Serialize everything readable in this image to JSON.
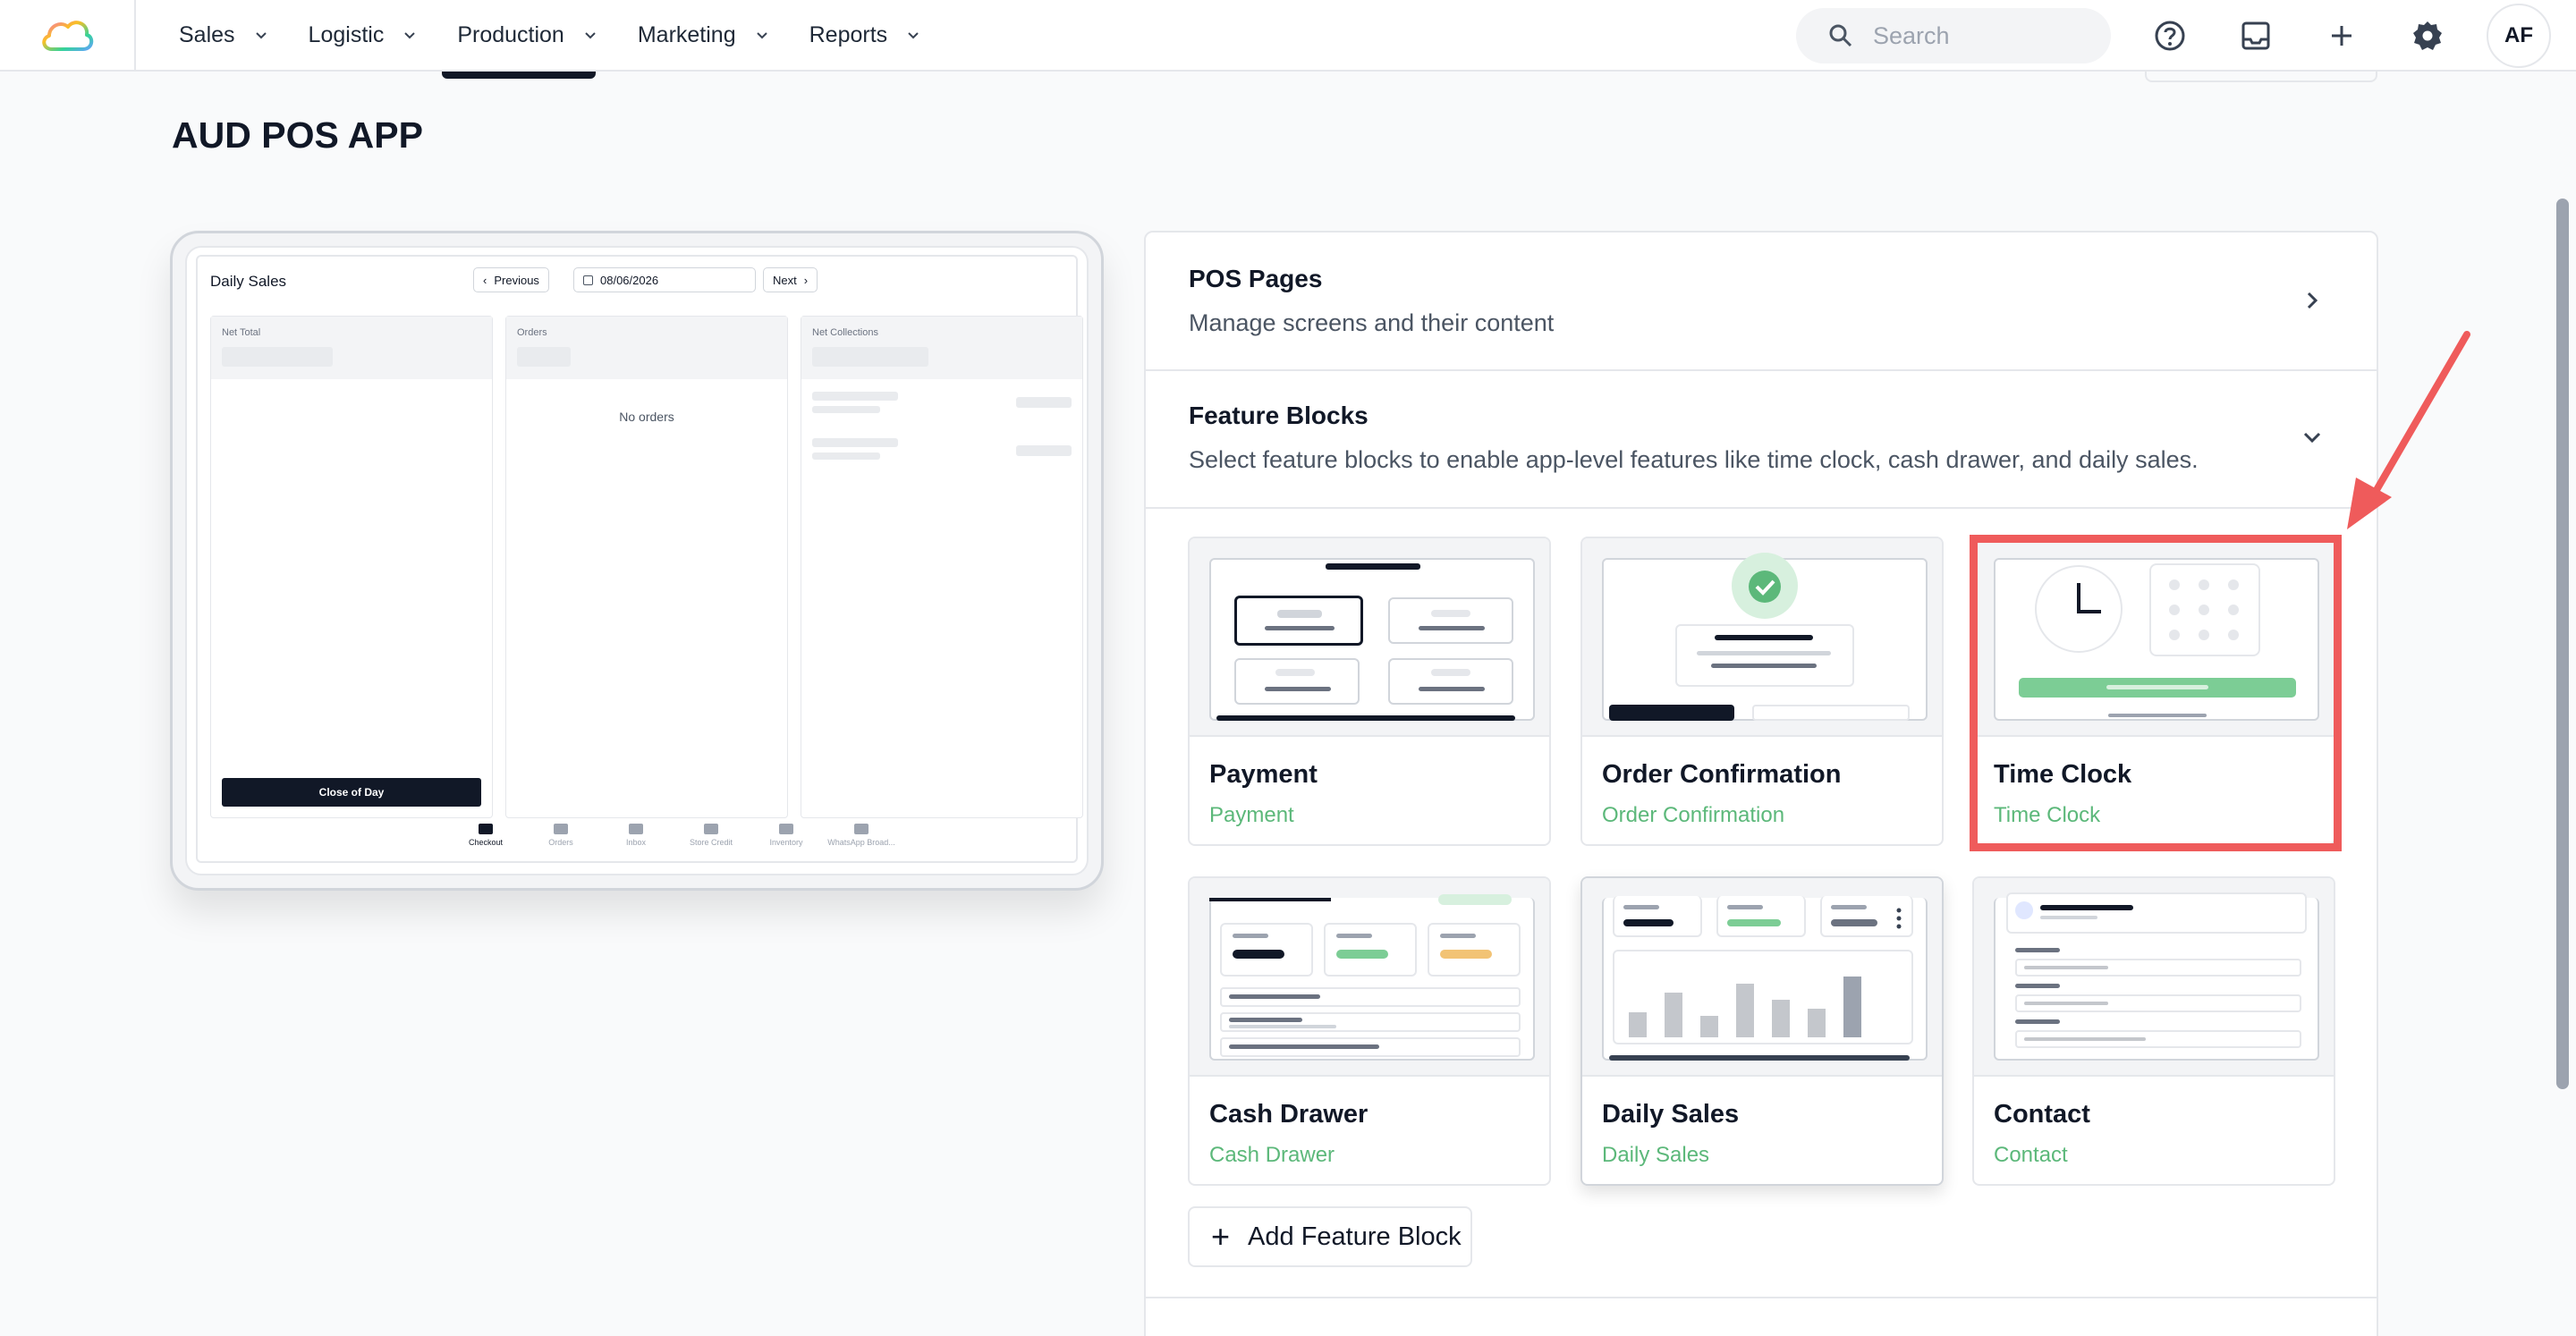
{
  "nav": {
    "items": [
      {
        "label": "Sales"
      },
      {
        "label": "Logistic"
      },
      {
        "label": "Production"
      },
      {
        "label": "Marketing"
      },
      {
        "label": "Reports"
      }
    ]
  },
  "header": {
    "search_placeholder": "Search",
    "avatar_initials": "AF"
  },
  "page": {
    "title": "AUD POS APP"
  },
  "preview": {
    "title": "Daily Sales",
    "prev_label": "Previous",
    "date": "08/06/2026",
    "next_label": "Next",
    "columns": [
      {
        "label": "Net Total"
      },
      {
        "label": "Orders"
      },
      {
        "label": "Net Collections"
      }
    ],
    "empty_orders": "No orders",
    "close_day_label": "Close of Day",
    "bottom_nav": [
      {
        "label": "Checkout"
      },
      {
        "label": "Orders"
      },
      {
        "label": "Inbox"
      },
      {
        "label": "Store Credit"
      },
      {
        "label": "Inventory"
      },
      {
        "label": "WhatsApp Broad..."
      }
    ]
  },
  "sections": {
    "pos_pages": {
      "title": "POS Pages",
      "description": "Manage screens and their content"
    },
    "feature_blocks": {
      "title": "Feature Blocks",
      "description": "Select feature blocks to enable app-level features like time clock, cash drawer, and daily sales."
    }
  },
  "feature_cards": [
    {
      "name": "Payment",
      "subtitle": "Payment"
    },
    {
      "name": "Order Confirmation",
      "subtitle": "Order Confirmation"
    },
    {
      "name": "Time Clock",
      "subtitle": "Time Clock"
    },
    {
      "name": "Cash Drawer",
      "subtitle": "Cash Drawer"
    },
    {
      "name": "Daily Sales",
      "subtitle": "Daily Sales"
    },
    {
      "name": "Contact",
      "subtitle": "Contact"
    }
  ],
  "add_feature_label": "Add Feature Block",
  "colors": {
    "accent_green": "#5cb87a",
    "highlight_red": "#ef5b5b",
    "dark": "#111827"
  }
}
